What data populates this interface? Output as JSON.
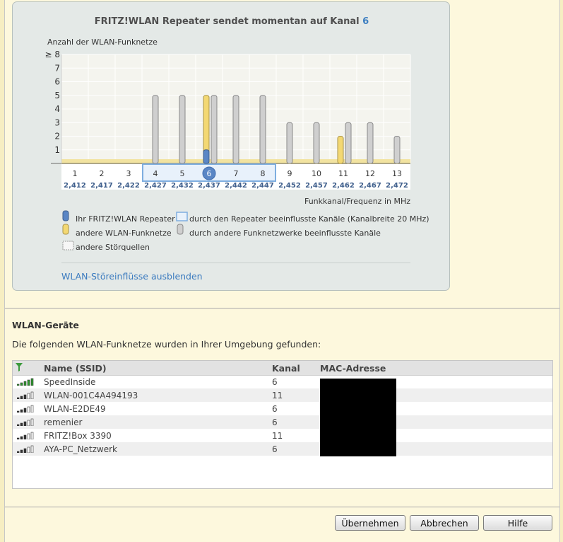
{
  "panel": {
    "title_prefix": "FRITZ!WLAN Repeater sendet momentan auf Kanal",
    "title_channel": "6"
  },
  "chart_data": {
    "type": "bar",
    "ylabel": "Anzahl der WLAN-Funknetze",
    "xlabel": "Funkkanal/Frequenz in MHz",
    "ylim": [
      0,
      8
    ],
    "y_ticks": [
      "1",
      "2",
      "3",
      "4",
      "5",
      "6",
      "7",
      "≥ 8"
    ],
    "categories": [
      "1",
      "2",
      "3",
      "4",
      "5",
      "6",
      "7",
      "8",
      "9",
      "10",
      "11",
      "12",
      "13"
    ],
    "frequencies": [
      "2,412",
      "2,417",
      "2,422",
      "2,427",
      "2,432",
      "2,437",
      "2,442",
      "2,447",
      "2,452",
      "2,457",
      "2,462",
      "2,467",
      "2,472"
    ],
    "current_channel": 6,
    "repeater_influenced_channels": [
      4,
      5,
      6,
      7,
      8
    ],
    "series": [
      {
        "name": "Ihr FRITZ!WLAN Repeater",
        "color": "#5a86c5",
        "values": [
          0,
          0,
          0,
          0,
          0,
          1,
          0,
          0,
          0,
          0,
          0,
          0,
          0
        ]
      },
      {
        "name": "andere WLAN-Funknetze",
        "color": "#f3d873",
        "values": [
          0,
          0,
          0,
          0,
          0,
          5,
          0,
          0,
          0,
          0,
          2,
          0,
          0
        ]
      },
      {
        "name": "durch andere Funknetzwerke beeinflusste Kanäle",
        "color": "#cfcfcf",
        "values": [
          0,
          0,
          0,
          5,
          5,
          5,
          5,
          5,
          3,
          3,
          3,
          3,
          2
        ]
      }
    ]
  },
  "legend": {
    "repeater": "Ihr FRITZ!WLAN Repeater",
    "other_networks": "andere WLAN-Funknetze",
    "other_interference": "andere Störquellen",
    "repeater_channels": "durch den Repeater beeinflusste Kanäle (Kanalbreite 20 MHz)",
    "other_channels": "durch andere Funknetzwerke beeinflusste Kanäle"
  },
  "toggle_link": "WLAN-Störeinflüsse ausblenden",
  "devices": {
    "heading": "WLAN-Geräte",
    "intro": "Die folgenden WLAN-Funknetze wurden in Ihrer Umgebung gefunden:",
    "columns": {
      "name": "Name (SSID)",
      "channel": "Kanal",
      "mac": "MAC-Adresse"
    },
    "rows": [
      {
        "ssid": "SpeedInside",
        "channel": "6",
        "signal": 5
      },
      {
        "ssid": "WLAN-001C4A494193",
        "channel": "11",
        "signal": 3
      },
      {
        "ssid": "WLAN-E2DE49",
        "channel": "6",
        "signal": 3
      },
      {
        "ssid": "remenier",
        "channel": "6",
        "signal": 3
      },
      {
        "ssid": "FRITZ!Box 3390",
        "channel": "11",
        "signal": 3
      },
      {
        "ssid": "AYA-PC_Netzwerk",
        "channel": "6",
        "signal": 3
      }
    ]
  },
  "buttons": {
    "apply": "Übernehmen",
    "cancel": "Abbrechen",
    "help": "Hilfe"
  }
}
